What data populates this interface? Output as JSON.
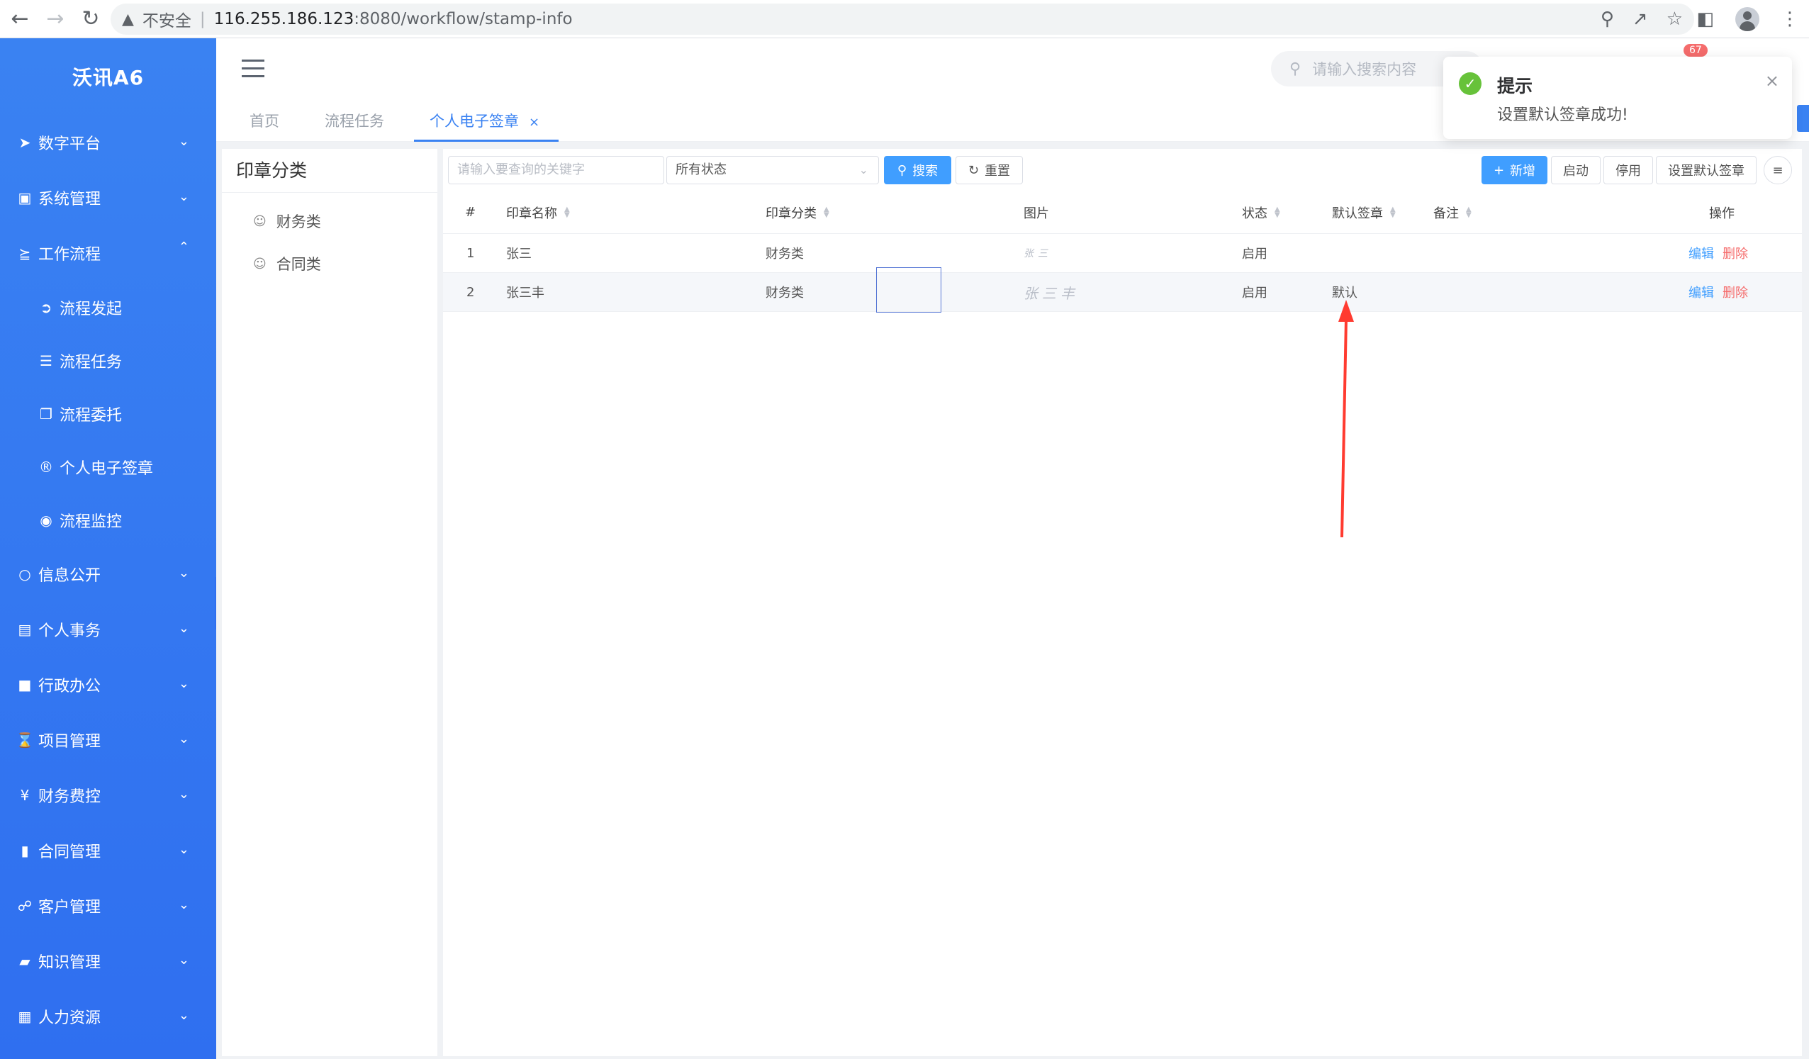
{
  "browser": {
    "insecure_label": "不安全",
    "url_host": "116.255.186.123",
    "url_path": ":8080/workflow/stamp-info"
  },
  "sidebar": {
    "logo": "沃讯A6",
    "items": [
      {
        "label": "数字平台",
        "icon": "paper-plane-icon"
      },
      {
        "label": "系统管理",
        "icon": "monitor-icon"
      },
      {
        "label": "工作流程",
        "icon": "share-icon",
        "expanded": true
      },
      {
        "label": "信息公开",
        "icon": "chat-icon"
      },
      {
        "label": "个人事务",
        "icon": "id-card-icon"
      },
      {
        "label": "行政办公",
        "icon": "briefcase-icon"
      },
      {
        "label": "项目管理",
        "icon": "hourglass-icon"
      },
      {
        "label": "财务费控",
        "icon": "yen-icon"
      },
      {
        "label": "合同管理",
        "icon": "file-icon"
      },
      {
        "label": "客户管理",
        "icon": "handshake-icon"
      },
      {
        "label": "知识管理",
        "icon": "book-icon"
      },
      {
        "label": "人力资源",
        "icon": "contact-icon"
      }
    ],
    "subitems": [
      {
        "label": "流程发起",
        "icon": "arrow-circle-icon"
      },
      {
        "label": "流程任务",
        "icon": "list-icon"
      },
      {
        "label": "流程委托",
        "icon": "copy-icon"
      },
      {
        "label": "个人电子签章",
        "icon": "registered-icon"
      },
      {
        "label": "流程监控",
        "icon": "eye-icon"
      }
    ]
  },
  "header": {
    "search_placeholder": "请输入搜索内容",
    "badge_count": "67"
  },
  "tabs": [
    {
      "label": "首页"
    },
    {
      "label": "流程任务"
    },
    {
      "label": "个人电子签章",
      "active": true
    }
  ],
  "category": {
    "title": "印章分类",
    "items": [
      "财务类",
      "合同类"
    ]
  },
  "toolbar": {
    "keyword_placeholder": "请输入要查询的关键字",
    "status_value": "所有状态",
    "search_label": "搜索",
    "reset_label": "重置",
    "add_label": "新增",
    "enable_label": "启动",
    "disable_label": "停用",
    "set_default_label": "设置默认签章"
  },
  "table": {
    "headers": {
      "index": "#",
      "name": "印章名称",
      "category": "印章分类",
      "image": "图片",
      "status": "状态",
      "default": "默认签章",
      "remark": "备注",
      "ops": "操作"
    },
    "rows": [
      {
        "index": "1",
        "name": "张三",
        "category": "财务类",
        "image": "张三",
        "status": "启用",
        "default": "",
        "remark": "",
        "edit": "编辑",
        "delete": "删除"
      },
      {
        "index": "2",
        "name": "张三丰",
        "category": "财务类",
        "image": "张三丰",
        "status": "启用",
        "default": "默认",
        "remark": "",
        "edit": "编辑",
        "delete": "删除"
      }
    ]
  },
  "toast": {
    "title": "提示",
    "message": "设置默认签章成功!"
  },
  "colors": {
    "sidebar": "#3a82f2",
    "primary": "#409eff",
    "danger": "#f56c6c",
    "success": "#67c23a",
    "annotation": "#ff3b30"
  }
}
